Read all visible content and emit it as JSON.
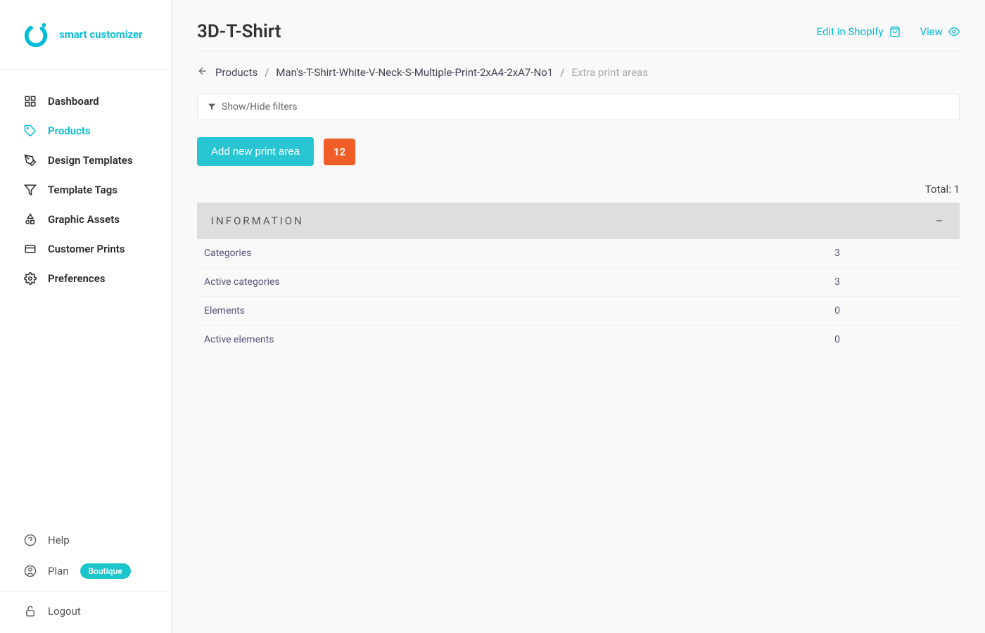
{
  "brand": {
    "name": "smart customizer"
  },
  "sidebar": {
    "items": [
      {
        "label": "Dashboard"
      },
      {
        "label": "Products"
      },
      {
        "label": "Design Templates"
      },
      {
        "label": "Template Tags"
      },
      {
        "label": "Graphic Assets"
      },
      {
        "label": "Customer Prints"
      },
      {
        "label": "Preferences"
      }
    ],
    "bottom": {
      "help": "Help",
      "plan": "Plan",
      "plan_badge": "Boutique",
      "logout": "Logout"
    }
  },
  "header": {
    "title": "3D-T-Shirt",
    "edit_label": "Edit in Shopify",
    "view_label": "View"
  },
  "breadcrumb": {
    "products": "Products",
    "product_name": "Man's-T-Shirt-White-V-Neck-S-Multiple-Print-2xA4-2xA7-No1",
    "current": "Extra print areas"
  },
  "filter": {
    "label": "Show/Hide filters"
  },
  "actions": {
    "add_button": "Add new print area",
    "count_badge": "12"
  },
  "total": {
    "prefix": "Total: ",
    "value": "1"
  },
  "section": {
    "title": "INFORMATION"
  },
  "info": {
    "rows": [
      {
        "label": "Categories",
        "value": "3"
      },
      {
        "label": "Active categories",
        "value": "3"
      },
      {
        "label": "Elements",
        "value": "0"
      },
      {
        "label": "Active elements",
        "value": "0"
      }
    ]
  }
}
